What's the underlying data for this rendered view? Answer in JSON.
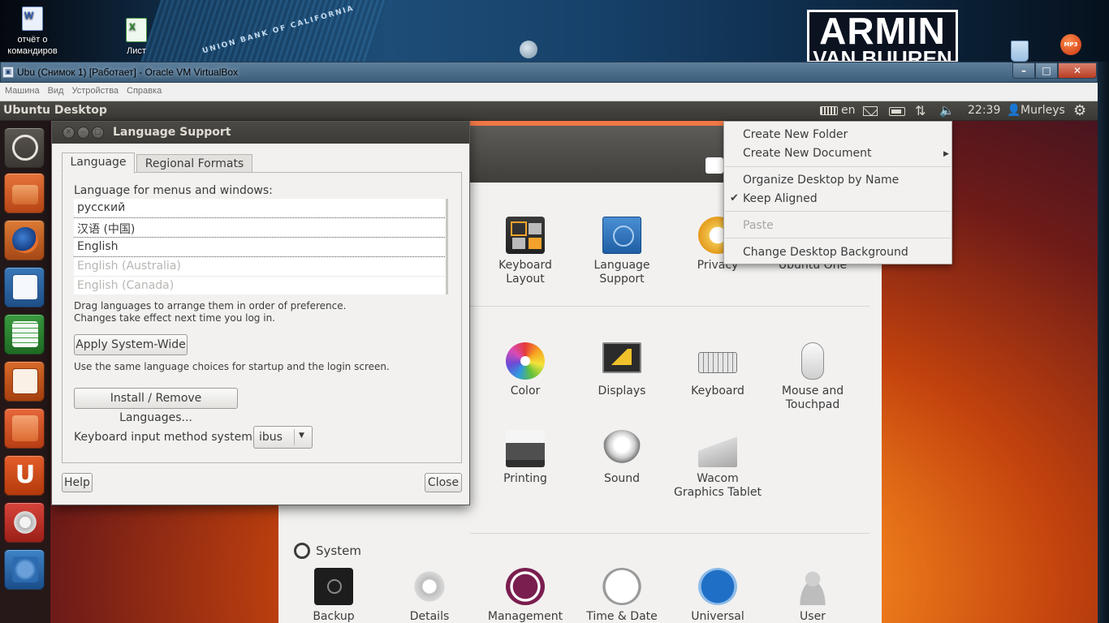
{
  "host": {
    "icons": [
      {
        "label_line1": "отчёт о",
        "label_line2": "командиров"
      },
      {
        "label_line1": "Лист"
      }
    ],
    "wallpaper_building_text": "UNION BANK OF CALIFORNIA",
    "logo_line1": "ARMIN",
    "logo_line2": "VAN BUUREN",
    "mp3_badge": "MP3"
  },
  "vbox": {
    "title": "Ubu (Снимок 1) [Работает] - Oracle VM VirtualBox",
    "menu": [
      "Машина",
      "Вид",
      "Устройства",
      "Справка"
    ],
    "controls": {
      "min": "–",
      "max": "□",
      "close": "✕"
    }
  },
  "panel": {
    "title": "Ubuntu Desktop",
    "keyboard_layout": "en",
    "clock": "22:39",
    "user": "Murleys"
  },
  "launcher": {
    "items": [
      "dash-home",
      "files",
      "firefox",
      "libreoffice-writer",
      "libreoffice-calc",
      "libreoffice-impress",
      "software-center",
      "ubuntu-one",
      "system-settings",
      "language-support"
    ],
    "ubuntu_one_glyph": "U"
  },
  "system_settings": {
    "items_row1": [
      {
        "label": "Keyboard Layout"
      },
      {
        "label": "Language Support"
      },
      {
        "label": "Privacy"
      },
      {
        "label": "Ubuntu One"
      }
    ],
    "items_row2": [
      {
        "label": "Color"
      },
      {
        "label": "Displays"
      },
      {
        "label": "Keyboard"
      },
      {
        "label": "Mouse and Touchpad"
      }
    ],
    "items_row3": [
      {
        "label": "Printing"
      },
      {
        "label": "Sound"
      },
      {
        "label": "Wacom Graphics Tablet"
      }
    ],
    "system_heading": "System",
    "items_system": [
      {
        "label": "Backup"
      },
      {
        "label": "Details"
      },
      {
        "label": "Management"
      },
      {
        "label": "Time & Date"
      },
      {
        "label": "Universal"
      },
      {
        "label": "User"
      }
    ]
  },
  "context_menu": {
    "create_folder": "Create New Folder",
    "create_document": "Create New Document",
    "organize": "Organize Desktop by Name",
    "keep_aligned": "Keep Aligned",
    "keep_aligned_checked": true,
    "paste": "Paste",
    "change_background": "Change Desktop Background"
  },
  "language_support": {
    "title": "Language Support",
    "tabs": [
      "Language",
      "Regional Formats"
    ],
    "active_tab": "Language",
    "list_label": "Language for menus and windows:",
    "languages": [
      {
        "name": "русский",
        "enabled": true
      },
      {
        "name": "汉语 (中国)",
        "enabled": true
      },
      {
        "name": "English",
        "enabled": true
      },
      {
        "name": "English (Australia)",
        "enabled": false
      },
      {
        "name": "English (Canada)",
        "enabled": false
      }
    ],
    "drag_hint_line1": "Drag languages to arrange them in order of preference.",
    "drag_hint_line2": "Changes take effect next time you log in.",
    "apply_button": "Apply System-Wide",
    "apply_hint": "Use the same language choices for startup and the login screen.",
    "install_button": "Install / Remove Languages...",
    "input_method_label": "Keyboard input method system:",
    "input_method_value": "ibus",
    "help_button": "Help",
    "close_button": "Close"
  }
}
